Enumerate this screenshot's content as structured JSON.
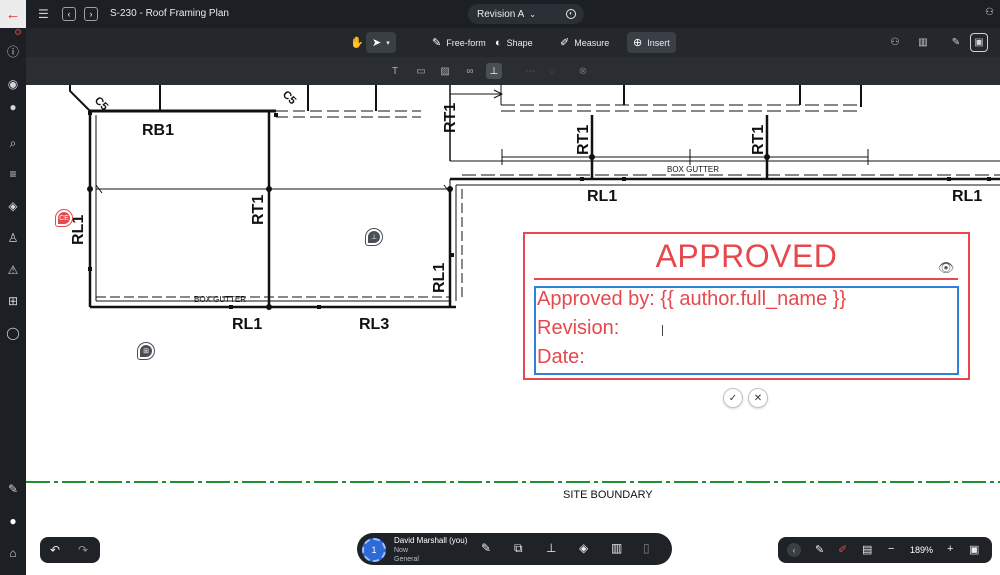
{
  "app": {
    "document_title": "S-230 - Roof Framing Plan",
    "revision": "Revision A"
  },
  "toolbar": {
    "tools": [
      {
        "name": "free-form",
        "label": "Free-form"
      },
      {
        "name": "shape",
        "label": "Shape"
      },
      {
        "name": "measure",
        "label": "Measure"
      },
      {
        "name": "insert",
        "label": "Insert"
      }
    ]
  },
  "drawing": {
    "labels": {
      "rb1": "RB1",
      "rl1_left": "RL1",
      "rt1_center": "RT1",
      "rl1_bottom": "RL1",
      "rl3": "RL3",
      "rl1_vertical": "RL1",
      "rt1_top": "RT1",
      "rt1_a": "RT1",
      "rt1_b": "RT1",
      "rl1_mid": "RL1",
      "rl1_right": "RL1",
      "box_gutter_left": "BOX GUTTER",
      "box_gutter_right": "BOX GUTTER",
      "c5_a": "C5",
      "c5_b": "C5",
      "site_boundary": "SITE BOUNDARY"
    },
    "pins": {
      "red_pin": "CE"
    }
  },
  "stamp": {
    "title": "APPROVED",
    "lines": [
      "Approved by: {{ author.full_name }}",
      "Revision:",
      "Date:"
    ]
  },
  "user": {
    "name": "David Marshall (you)",
    "status": "Now",
    "channel": "General",
    "avatar_number": "1"
  },
  "zoom": {
    "level": "189%"
  },
  "colors": {
    "stamp_red": "#e5484d",
    "field_blue": "#2f80d8",
    "boundary_green": "#1f8f2f",
    "chrome_dark": "#1c1f24"
  }
}
